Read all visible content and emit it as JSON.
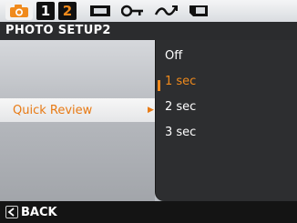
{
  "tabs": {
    "camera_icon": "camera-icon",
    "page_1": "1",
    "page_2": "2",
    "icons": [
      "display-icon",
      "key-icon",
      "sweep-icon",
      "memory-card-icon"
    ]
  },
  "header": {
    "title": "PHOTO SETUP2"
  },
  "menu": {
    "item_label": "Quick Review"
  },
  "options": {
    "items": [
      "Off",
      "1 sec",
      "2 sec",
      "3 sec"
    ],
    "selected_index": 1
  },
  "footer": {
    "back_label": "BACK"
  },
  "colors": {
    "accent": "#f08a1c",
    "title_bar": "#2b2c2e"
  }
}
